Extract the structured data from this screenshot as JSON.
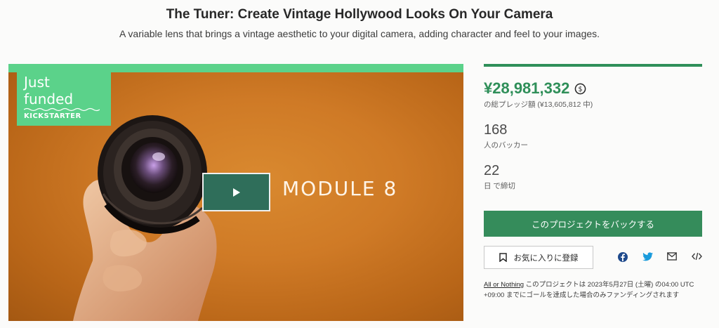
{
  "header": {
    "title": "The Tuner: Create Vintage Hollywood Looks On Your Camera",
    "subtitle": "A variable lens that brings a vintage aesthetic to your digital camera, adding character and feel to your images."
  },
  "video": {
    "badge_line1": "Just",
    "badge_line2": "funded",
    "badge_brand": "KICKSTARTER",
    "brand_text": "MODULE 8",
    "play_icon": "play-icon"
  },
  "stats": {
    "pledged": "¥28,981,332",
    "pledged_label": "の総プレッジ額 (¥13,605,812 中)",
    "backers": "168",
    "backers_label": "人のバッカー",
    "days": "22",
    "days_label": "日 で締切"
  },
  "actions": {
    "back_label": "このプロジェクトをバックする",
    "remind_label": "お気に入りに登録"
  },
  "share_icons": [
    "facebook-icon",
    "twitter-icon",
    "mail-icon",
    "embed-icon"
  ],
  "note": {
    "link": "All or Nothing",
    "text": " このプロジェクトは 2023年5月27日 (土曜) の04:00 UTC +09:00 までにゴールを達成した場合のみファンディングされます"
  },
  "colors": {
    "accent": "#358c5b",
    "badge": "#5bd28a",
    "video_bg": "#cf7a26",
    "play_button": "#2f6e5a"
  }
}
